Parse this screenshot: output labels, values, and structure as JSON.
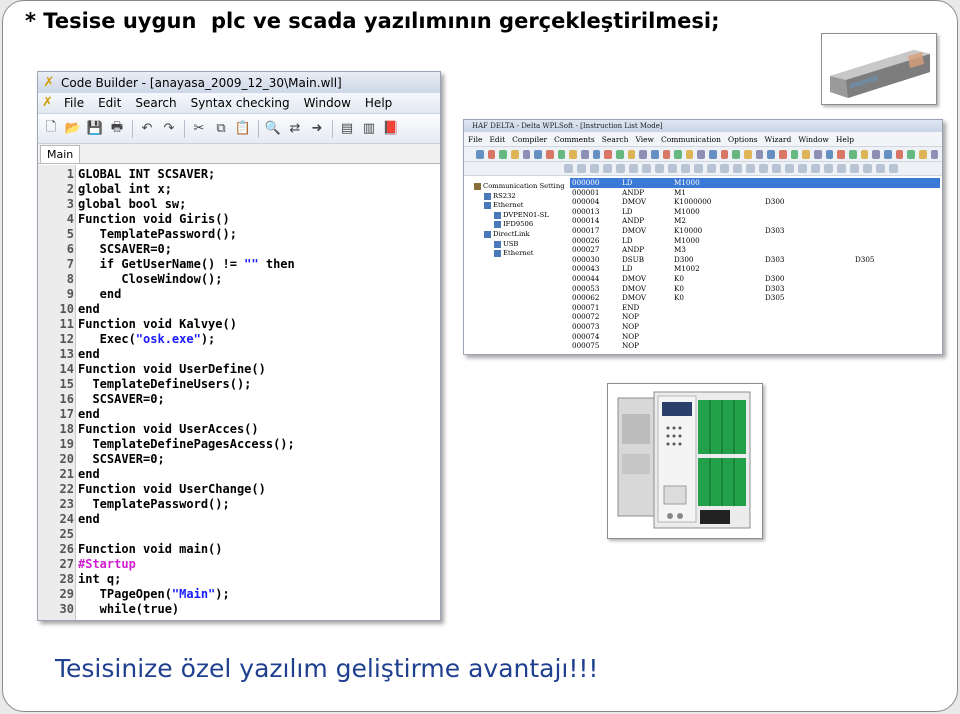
{
  "slide": {
    "title": "* Tesise uygun  plc ve scada yazılımının gerçekleştirilmesi;",
    "caption": "Tesisinize özel yazılım geliştirme avantajı!!!"
  },
  "code_builder": {
    "window_title": "Code Builder - [anayasa_2009_12_30\\Main.wll]",
    "menu": [
      "File",
      "Edit",
      "Search",
      "Syntax checking",
      "Window",
      "Help"
    ],
    "toolbar_icons": [
      "new-icon",
      "open-icon",
      "save-icon",
      "print-icon",
      "undo-icon",
      "redo-icon",
      "cut-icon",
      "copy-icon",
      "paste-icon",
      "find-icon",
      "replace-icon",
      "goto-icon",
      "compile-icon",
      "build-icon",
      "help-book-icon"
    ],
    "tab": "Main",
    "lines": [
      {
        "n": "1",
        "text": "GLOBAL INT SCSAVER;"
      },
      {
        "n": "2",
        "text": "global int x;"
      },
      {
        "n": "3",
        "text": "global bool sw;"
      },
      {
        "n": "4",
        "text": "Function void Giris()"
      },
      {
        "n": "5",
        "text": "   TemplatePassword();"
      },
      {
        "n": "6",
        "text": "   SCSAVER=0;"
      },
      {
        "n": "7",
        "pre": "   if GetUserName() != ",
        "str": "\"\"",
        "post": " then"
      },
      {
        "n": "8",
        "text": "      CloseWindow();"
      },
      {
        "n": "9",
        "text": "   end"
      },
      {
        "n": "10",
        "text": "end"
      },
      {
        "n": "11",
        "text": "Function void Kalvye()"
      },
      {
        "n": "12",
        "pre": "   Exec(",
        "str": "\"osk.exe\"",
        "post": ");"
      },
      {
        "n": "13",
        "text": "end"
      },
      {
        "n": "14",
        "text": "Function void UserDefine()"
      },
      {
        "n": "15",
        "text": "  TemplateDefineUsers();"
      },
      {
        "n": "16",
        "text": "  SCSAVER=0;"
      },
      {
        "n": "17",
        "text": "end"
      },
      {
        "n": "18",
        "text": "Function void UserAcces()"
      },
      {
        "n": "19",
        "text": "  TemplateDefinePagesAccess();"
      },
      {
        "n": "20",
        "text": "  SCSAVER=0;"
      },
      {
        "n": "21",
        "text": "end"
      },
      {
        "n": "22",
        "text": "Function void UserChange()"
      },
      {
        "n": "23",
        "text": "  TemplatePassword();"
      },
      {
        "n": "24",
        "text": "end"
      },
      {
        "n": "25",
        "text": ""
      },
      {
        "n": "26",
        "text": "Function void main()"
      },
      {
        "n": "27",
        "dir": "#Startup"
      },
      {
        "n": "28",
        "text": "int q;"
      },
      {
        "n": "29",
        "pre": "   TPageOpen(",
        "str": "\"Main\"",
        "post": ");"
      },
      {
        "n": "30",
        "text": "   while(true)"
      }
    ]
  },
  "wplsoft": {
    "window_title": "HAF DELTA - Delta WPLSoft - [Instruction List Mode]",
    "menu": [
      "File",
      "Edit",
      "Compiler",
      "Comments",
      "Search",
      "View",
      "Communication",
      "Options",
      "Wizard",
      "Window",
      "Help"
    ],
    "tree": [
      {
        "label": "Communication Setting",
        "level": 0
      },
      {
        "label": "RS232",
        "level": 1
      },
      {
        "label": "Ethernet",
        "level": 1
      },
      {
        "label": "DVPEN01-SL",
        "level": 2
      },
      {
        "label": "IFD9506",
        "level": 2
      },
      {
        "label": "DirectLink",
        "level": 1
      },
      {
        "label": "USB",
        "level": 2
      },
      {
        "label": "Ethernet",
        "level": 2
      }
    ],
    "instructions": [
      [
        "000000",
        "LD",
        "M1000",
        "",
        ""
      ],
      [
        "000001",
        "ANDP",
        "M1",
        "",
        ""
      ],
      [
        "000004",
        "DMOV",
        "K1000000",
        "D300",
        ""
      ],
      [
        "000013",
        "LD",
        "M1000",
        "",
        ""
      ],
      [
        "000014",
        "ANDP",
        "M2",
        "",
        ""
      ],
      [
        "000017",
        "DMOV",
        "K10000",
        "D303",
        ""
      ],
      [
        "000026",
        "LD",
        "M1000",
        "",
        ""
      ],
      [
        "000027",
        "ANDP",
        "M3",
        "",
        ""
      ],
      [
        "000030",
        "DSUB",
        "D300",
        "D303",
        "D305"
      ],
      [
        "000043",
        "LD",
        "M1002",
        "",
        ""
      ],
      [
        "000044",
        "DMOV",
        "K0",
        "D300",
        ""
      ],
      [
        "000053",
        "DMOV",
        "K0",
        "D303",
        ""
      ],
      [
        "000062",
        "DMOV",
        "K0",
        "D305",
        ""
      ],
      [
        "000071",
        "END",
        "",
        "",
        ""
      ],
      [
        "000072",
        "NOP",
        "",
        "",
        ""
      ],
      [
        "000073",
        "NOP",
        "",
        "",
        ""
      ],
      [
        "000074",
        "NOP",
        "",
        "",
        ""
      ],
      [
        "000075",
        "NOP",
        "",
        "",
        ""
      ]
    ],
    "selected_row": 0
  },
  "colors": {
    "caption": "#1f3f8f",
    "selection": "#3a7ad6",
    "string": "#1a1aff",
    "directive": "#d01fd0"
  }
}
